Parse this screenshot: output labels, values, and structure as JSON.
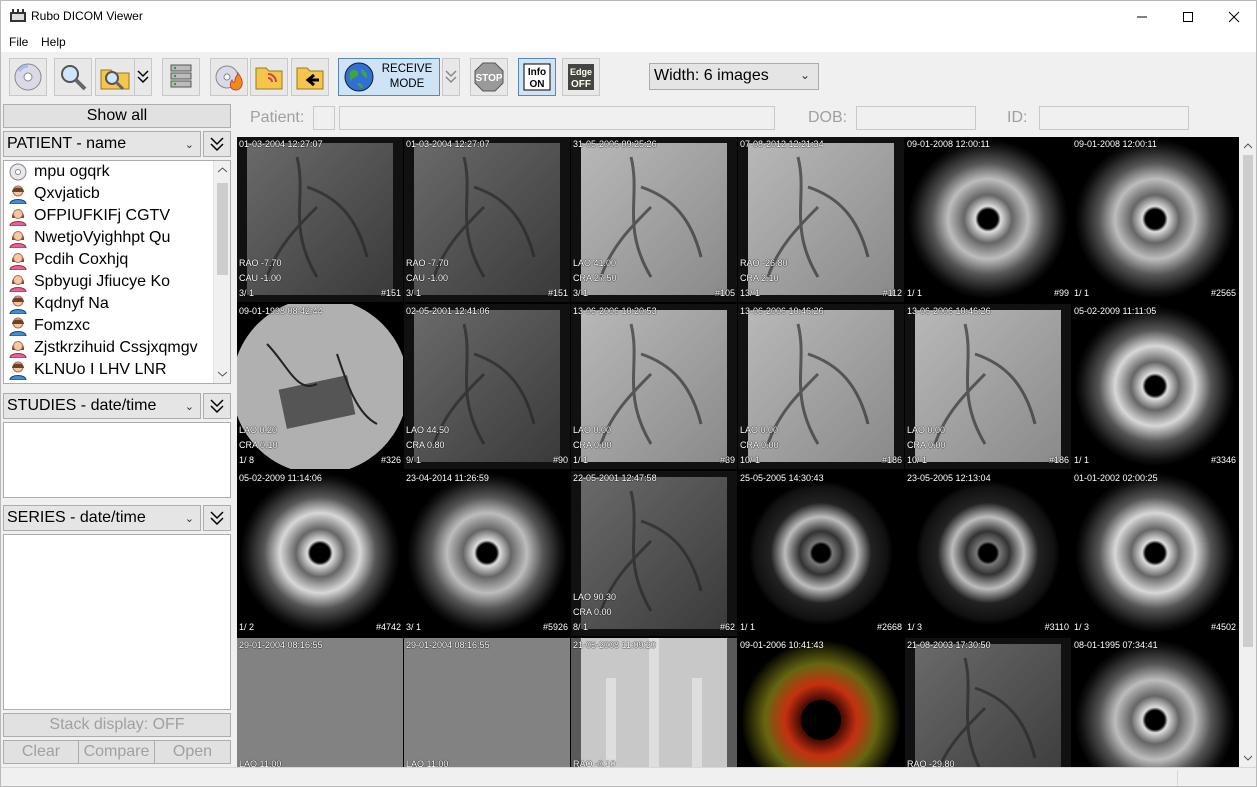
{
  "window": {
    "title": "Rubo DICOM Viewer"
  },
  "menu": {
    "file": "File",
    "help": "Help"
  },
  "toolbar": {
    "receive_line1": "RECEIVE",
    "receive_line2": "MODE",
    "width_select": "Width: 6 images"
  },
  "left": {
    "show_all": "Show all",
    "patient_combo": "PATIENT - name",
    "studies_combo": "STUDIES - date/time",
    "series_combo": "SERIES - date/time",
    "stack_display": "Stack display: OFF",
    "clear": "Clear",
    "compare": "Compare",
    "open": "Open",
    "patients": [
      {
        "name": "mpu ogqrk",
        "icon": "disc"
      },
      {
        "name": "Qxvjaticb",
        "icon": "male"
      },
      {
        "name": "OFPIUFKIFj CGTV",
        "icon": "female"
      },
      {
        "name": "NwetjoVyighhpt Qu",
        "icon": "female"
      },
      {
        "name": "Pcdih Coxhjq",
        "icon": "female"
      },
      {
        "name": "Spbyugi Jfiucye Ko",
        "icon": "female"
      },
      {
        "name": "Kqdnyf Na",
        "icon": "male"
      },
      {
        "name": "Fomzxc",
        "icon": "male"
      },
      {
        "name": "Zjstkrzihuid Cssjxqmgv",
        "icon": "female"
      },
      {
        "name": "KLNUo I LHV LNR",
        "icon": "male"
      }
    ]
  },
  "infobar": {
    "patient": "Patient:",
    "dob": "DOB:",
    "id": "ID:"
  },
  "tiles": [
    {
      "dt": "01-03-2004  12:27:07",
      "o1": "RAO -7.70",
      "o2": "CAU -1.00",
      "fr": "3/ 1",
      "id": "#151",
      "kind": "angio"
    },
    {
      "dt": "01-03-2004  12:27:07",
      "o1": "RAO -7.70",
      "o2": "CAU -1.00",
      "fr": "3/ 1",
      "id": "#151",
      "kind": "angio"
    },
    {
      "dt": "31-05-2006  09:25:26",
      "o1": "LAO 41.00",
      "o2": "CRA 27.50",
      "fr": "3/ 1",
      "id": "#105",
      "kind": "angio-light"
    },
    {
      "dt": "07-08-2012  12:21:34",
      "o1": "RAO -26.80",
      "o2": "CRA 2.10",
      "fr": "13/ 1",
      "id": "#112",
      "kind": "angio-light"
    },
    {
      "dt": "09-01-2008  12:00:11",
      "o1": "",
      "o2": "",
      "fr": "1/ 1",
      "id": "#99",
      "kind": "ivus"
    },
    {
      "dt": "09-01-2008  12:00:11",
      "o1": "",
      "o2": "",
      "fr": "1/ 1",
      "id": "#2565",
      "kind": "ivus"
    },
    {
      "dt": "09-01-1998  08:42:44",
      "o1": "LAO 0.20",
      "o2": "CRA 0.10",
      "fr": "1/ 8",
      "id": "#326",
      "kind": "xray-round"
    },
    {
      "dt": "02-05-2001  12:41:06",
      "o1": "LAO 44.50",
      "o2": "CRA 0.80",
      "fr": "9/ 1",
      "id": "#90",
      "kind": "angio"
    },
    {
      "dt": "13-06-2006  10:20:53",
      "o1": "LAO 0.00",
      "o2": "CRA 0.00",
      "fr": "1/ 1",
      "id": "#39",
      "kind": "angio-light"
    },
    {
      "dt": "13-06-2006  10:46:26",
      "o1": "LAO 0.00",
      "o2": "CRA 0.00",
      "fr": "10/ 1",
      "id": "#186",
      "kind": "angio-light"
    },
    {
      "dt": "13-06-2006  10:46:26",
      "o1": "LAO 0.00",
      "o2": "CRA 0.00",
      "fr": "10/ 1",
      "id": "#186",
      "kind": "angio-light"
    },
    {
      "dt": "05-02-2009  11:11:05",
      "o1": "",
      "o2": "",
      "fr": "1/ 1",
      "id": "#3346",
      "kind": "ivus-bright"
    },
    {
      "dt": "05-02-2009  11:14:06",
      "o1": "",
      "o2": "",
      "fr": "1/ 2",
      "id": "#4742",
      "kind": "ivus-bright"
    },
    {
      "dt": "23-04-2014  11:26:59",
      "o1": "",
      "o2": "",
      "fr": "3/ 1",
      "id": "#5926",
      "kind": "ivus"
    },
    {
      "dt": "22-05-2001  12:47:58",
      "o1": "LAO 90.30",
      "o2": "CRA 0.00",
      "fr": "8/ 1",
      "id": "#62",
      "kind": "angio"
    },
    {
      "dt": "25-05-2005  14:30:43",
      "o1": "",
      "o2": "",
      "fr": "1/ 1",
      "id": "#2668",
      "kind": "ivus-dark"
    },
    {
      "dt": "23-05-2005  12:13:04",
      "o1": "",
      "o2": "",
      "fr": "1/ 3",
      "id": "#3110",
      "kind": "ivus-dark"
    },
    {
      "dt": "01-01-2002  02:00:25",
      "o1": "",
      "o2": "",
      "fr": "1/ 3",
      "id": "#4502",
      "kind": "ivus-bright"
    },
    {
      "dt": "29-01-2004  08:16:55",
      "o1": "LAO 11.00",
      "o2": "",
      "fr": "",
      "id": "",
      "kind": "flat"
    },
    {
      "dt": "29-01-2004  08:16:55",
      "o1": "LAO 11.00",
      "o2": "",
      "fr": "",
      "id": "",
      "kind": "flat"
    },
    {
      "dt": "21-05-2008  11:09:20",
      "o1": "RAO -0.10",
      "o2": "",
      "fr": "",
      "id": "",
      "kind": "chest"
    },
    {
      "dt": "09-01-2006  10:41:43",
      "o1": "",
      "o2": "",
      "fr": "",
      "id": "",
      "kind": "ivus-red"
    },
    {
      "dt": "21-08-2003  17:30:50",
      "o1": "RAO -29.80",
      "o2": "",
      "fr": "",
      "id": "",
      "kind": "angio"
    },
    {
      "dt": "08-01-1995  07:34:41",
      "o1": "",
      "o2": "",
      "fr": "",
      "id": "",
      "kind": "ivus"
    }
  ]
}
